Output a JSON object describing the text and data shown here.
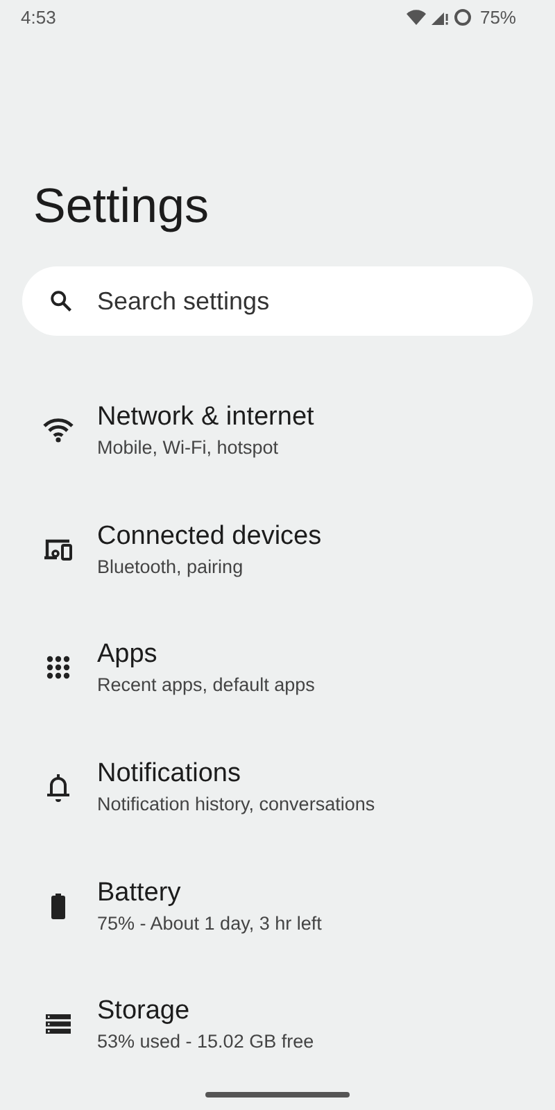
{
  "status_bar": {
    "time": "4:53",
    "battery": "75%"
  },
  "title": "Settings",
  "search": {
    "placeholder": "Search settings"
  },
  "items": [
    {
      "title": "Network & internet",
      "subtitle": "Mobile, Wi-Fi, hotspot"
    },
    {
      "title": "Connected devices",
      "subtitle": "Bluetooth, pairing"
    },
    {
      "title": "Apps",
      "subtitle": "Recent apps, default apps"
    },
    {
      "title": "Notifications",
      "subtitle": "Notification history, conversations"
    },
    {
      "title": "Battery",
      "subtitle": "75% - About 1 day, 3 hr left"
    },
    {
      "title": "Storage",
      "subtitle": "53% used - 15.02 GB free"
    }
  ]
}
